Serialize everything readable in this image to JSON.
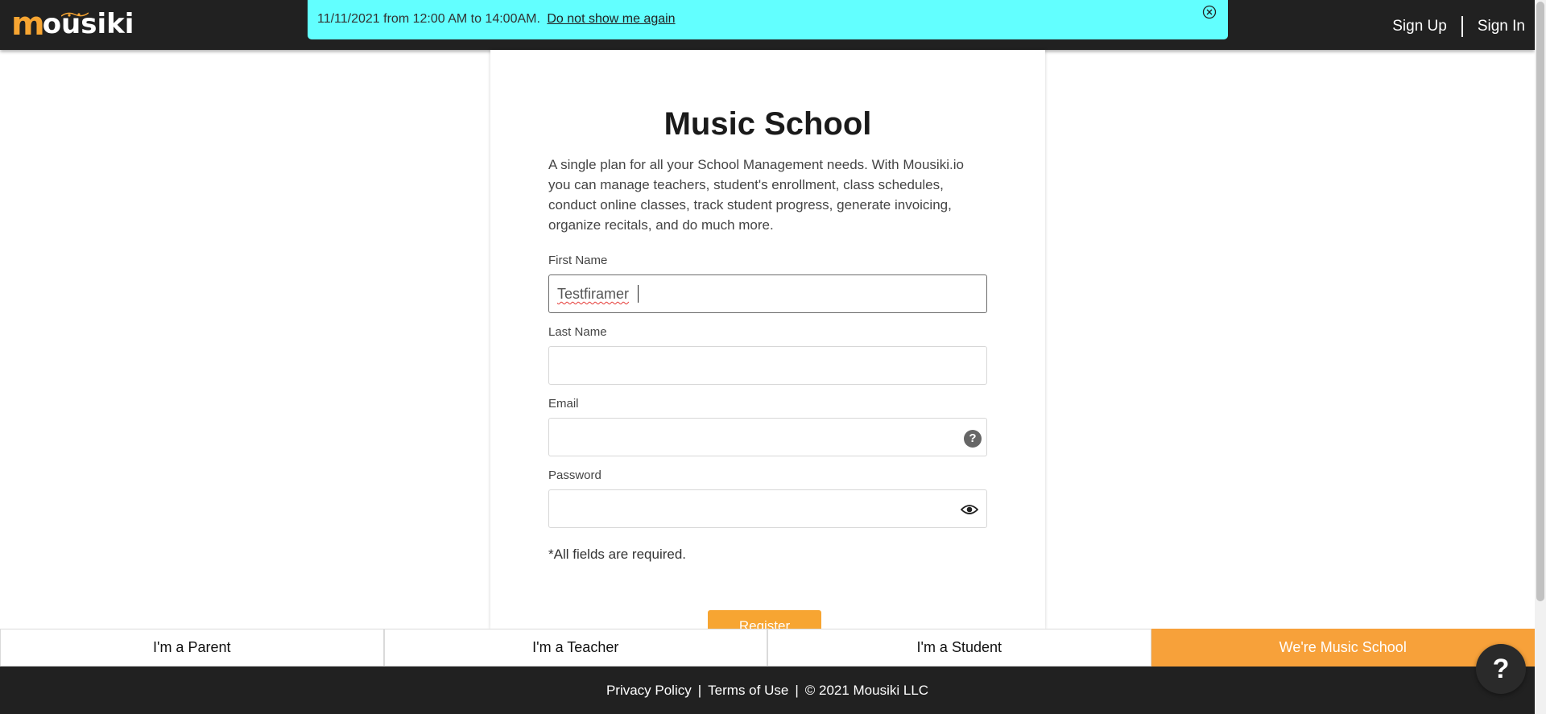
{
  "header": {
    "logo_initial": "m",
    "logo_rest": "ousiki",
    "signup_label": "Sign Up",
    "signin_label": "Sign In"
  },
  "banner": {
    "message": "11/11/2021 from 12:00 AM to 14:00AM.",
    "dismiss_link": "Do not show me again",
    "close_icon": "close-circle-icon"
  },
  "card": {
    "title": "Music School",
    "description": "A single plan for all your School Management needs. With Mousiki.io you can manage teachers, student's enrollment, class schedules, conduct online classes, track student progress, generate invoicing, organize recitals, and do much more.",
    "fields": {
      "first_name": {
        "label": "First Name",
        "value": "Testfiramer"
      },
      "last_name": {
        "label": "Last Name",
        "value": ""
      },
      "email": {
        "label": "Email",
        "value": "",
        "icon": "help-icon"
      },
      "password": {
        "label": "Password",
        "value": "",
        "icon": "eye-icon"
      }
    },
    "required_note": "*All fields are required.",
    "register_label": "Register"
  },
  "roles": [
    {
      "label": "I'm a Parent",
      "active": false
    },
    {
      "label": "I'm a Teacher",
      "active": false
    },
    {
      "label": "I'm a Student",
      "active": false
    },
    {
      "label": "We're Music School",
      "active": true
    }
  ],
  "footer": {
    "privacy": "Privacy Policy",
    "sep": "|",
    "terms": "Terms of Use",
    "copyright": "© 2021 Mousiki LLC"
  },
  "chat": {
    "label": "?"
  },
  "colors": {
    "brand_orange": "#f7a532",
    "banner_cyan": "#62ffff",
    "dark": "#212121"
  }
}
